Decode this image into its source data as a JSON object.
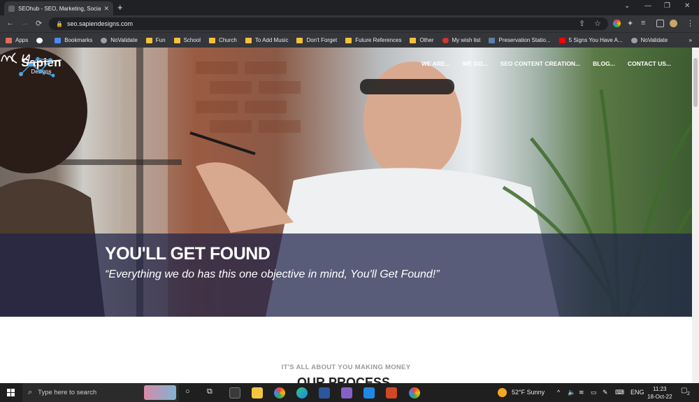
{
  "browser": {
    "tab_title": "SEOhub - SEO, Marketing, Social",
    "tab_close": "✕",
    "new_tab": "+",
    "window_controls": [
      "⌄",
      "—",
      "❐",
      "✕"
    ],
    "url": "seo.sapiendesigns.com",
    "bookmarks": [
      "Apps",
      "Bookmarks",
      "NoValidate",
      "Fun",
      "School",
      "Church",
      "To Add Music",
      "Don't Forget",
      "Future References",
      "Other",
      "My wish list",
      "Preservation Statio...",
      "5 Signs You Have A...",
      "NoValidate"
    ],
    "bookmarks_more": "»"
  },
  "site": {
    "logo_name": "Sapien",
    "logo_sub": "Designs",
    "nav": [
      "WE ARE...",
      "WE DO...",
      "SEO CONTENT CREATION...",
      "BLOG...",
      "CONTACT US..."
    ],
    "hero_title": "YOU'LL GET FOUND",
    "hero_quote": "“Everything we do has this one objective in mind, You'll Get Found!”",
    "section_kicker": "IT'S ALL ABOUT YOU MAKING MONEY",
    "section_title": "OUR PROCESS"
  },
  "taskbar": {
    "search_placeholder": "Type here to search",
    "weather": "52°F  Sunny",
    "lang": "ENG",
    "time": "11:23",
    "date": "18-Oct-22",
    "notifications": "2"
  }
}
